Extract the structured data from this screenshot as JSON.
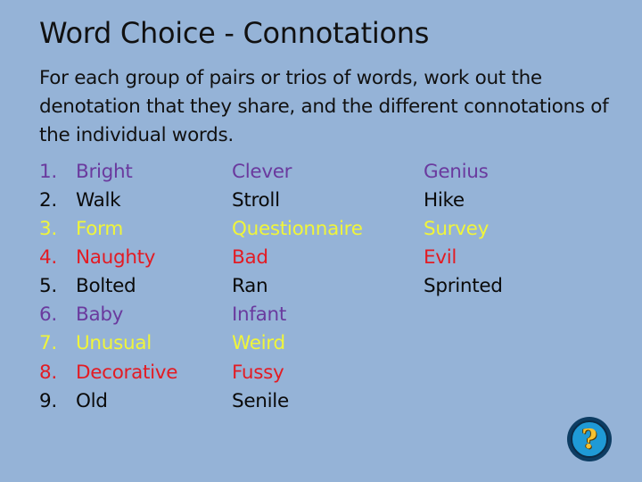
{
  "slide": {
    "title": "Word Choice - Connotations",
    "intro": "For each group of pairs or trios of words, work out the denotation that they share, and the different connotations of the individual words."
  },
  "colors": {
    "purple": "#7030a0",
    "black": "#0a0a0a",
    "yellow": "#ffff33",
    "red": "#e31b23"
  },
  "rows": [
    {
      "num": "1.",
      "color": "#6a3a9e",
      "words": [
        "Bright",
        "Clever",
        "Genius"
      ]
    },
    {
      "num": "2.",
      "color": "#0a0a0a",
      "words": [
        "Walk",
        "Stroll",
        "Hike"
      ]
    },
    {
      "num": "3.",
      "color": "#f0f53a",
      "words": [
        "Form",
        "Questionnaire",
        "Survey"
      ]
    },
    {
      "num": "4.",
      "color": "#e31b23",
      "words": [
        "Naughty",
        "Bad",
        "Evil"
      ]
    },
    {
      "num": "5.",
      "color": "#0a0a0a",
      "words": [
        "Bolted",
        "Ran",
        "Sprinted"
      ]
    },
    {
      "num": "6.",
      "color": "#6a3a9e",
      "words": [
        "Baby",
        "Infant",
        ""
      ]
    },
    {
      "num": "7.",
      "color": "#f0f53a",
      "words": [
        "Unusual",
        "Weird",
        ""
      ]
    },
    {
      "num": "8.",
      "color": "#e31b23",
      "words": [
        "Decorative",
        "Fussy",
        ""
      ]
    },
    {
      "num": "9.",
      "color": "#0a0a0a",
      "words": [
        "Old",
        "Senile",
        ""
      ]
    }
  ],
  "help_button": {
    "icon": "question-mark-icon",
    "glyph": "?"
  }
}
